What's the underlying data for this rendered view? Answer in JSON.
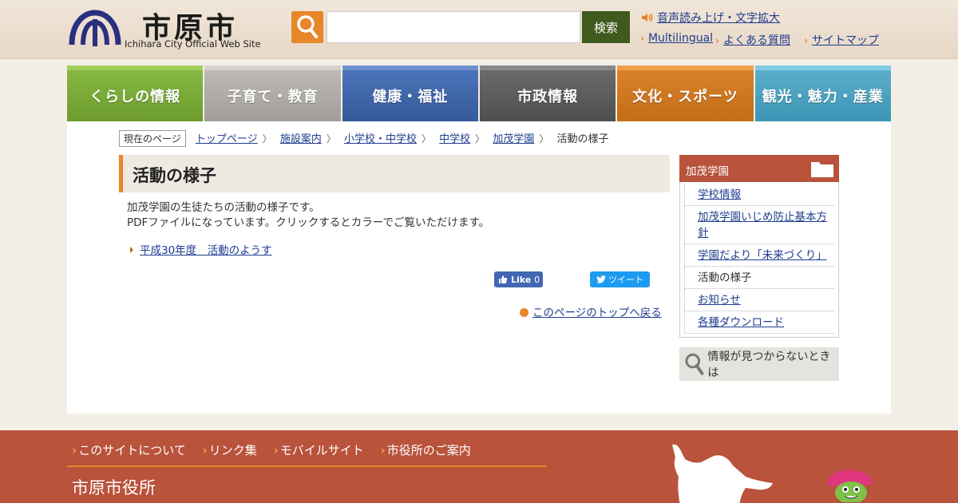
{
  "header": {
    "city_name": "市原市",
    "city_subtitle": "Ichihara City Official Web Site",
    "search_button": "検索",
    "search_placeholder": "",
    "links": {
      "speech": "音声読み上げ・文字拡大",
      "multilingual": "Multilingual",
      "faq": "よくある質問",
      "sitemap": "サイトマップ"
    }
  },
  "nav": {
    "items": [
      {
        "label": "くらしの情報"
      },
      {
        "label": "子育て・教育"
      },
      {
        "label": "健康・福祉"
      },
      {
        "label": "市政情報"
      },
      {
        "label": "文化・スポーツ"
      },
      {
        "label": "観光・魅力・産業"
      }
    ]
  },
  "breadcrumb": {
    "label": "現在のページ",
    "items": [
      "トップページ",
      "施設案内",
      "小学校・中学校",
      "中学校",
      "加茂学園"
    ],
    "current": "活動の様子"
  },
  "content": {
    "title": "活動の様子",
    "intro_line1": "加茂学園の生徒たちの活動の様子です。",
    "intro_line2": "PDFファイルになっています。クリックするとカラーでご覧いただけます。",
    "doc_link": "平成30年度　活動のようす",
    "like_label": "Like",
    "like_count": "0",
    "tweet_label": "ツイート",
    "page_top": "このページのトップへ戻る"
  },
  "sidebar": {
    "title": "加茂学園",
    "items": [
      {
        "label": "学校情報"
      },
      {
        "label": "加茂学園いじめ防止基本方針"
      },
      {
        "label": "学園だより「未来づくり」"
      },
      {
        "label": "活動の様子"
      },
      {
        "label": "お知らせ"
      },
      {
        "label": "各種ダウンロード"
      }
    ],
    "not_found": "情報が見つからないときは"
  },
  "footer": {
    "links": [
      "このサイトについて",
      "リンク集",
      "モバイルサイト",
      "市役所のご案内"
    ],
    "org_name": "市原市役所"
  },
  "colors": {
    "accent_orange": "#e8862a",
    "footer_red": "#b9533b",
    "link_blue": "#1e3d8f",
    "search_button_green": "#3f5a1c"
  }
}
